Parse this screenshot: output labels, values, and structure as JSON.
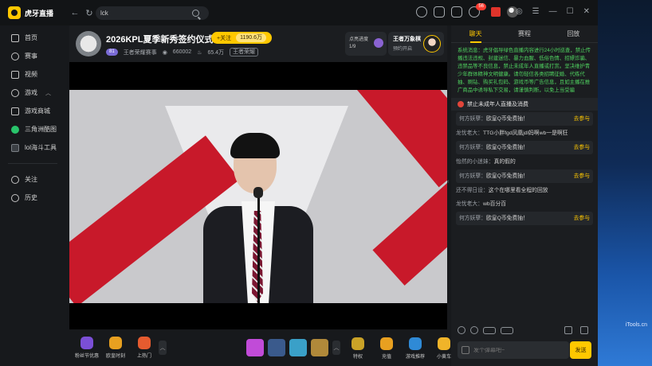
{
  "app": {
    "name": "虎牙直播",
    "search_value": "lck",
    "message_count": "56"
  },
  "sidebar": {
    "items": [
      {
        "label": "首页",
        "icon": "home-icon"
      },
      {
        "label": "赛事",
        "icon": "trophy-icon"
      },
      {
        "label": "视频",
        "icon": "video-icon"
      },
      {
        "label": "游戏",
        "icon": "gamepad-icon"
      },
      {
        "label": "游戏商城",
        "icon": "store-icon"
      },
      {
        "label": "三角洲酷图",
        "icon": "map-icon"
      },
      {
        "label": "lol海斗工具",
        "icon": "tool-icon"
      },
      {
        "label": "关注",
        "icon": "user-follow-icon"
      },
      {
        "label": "历史",
        "icon": "history-icon"
      }
    ]
  },
  "room": {
    "title": "2026KPL夏季新秀签约仪式",
    "follow_label": "+关注",
    "follow_count": "1190.6万",
    "level": "81",
    "host": "王者荣耀赛事",
    "viewers": "660002",
    "heat": "65.4万",
    "category": "王者荣耀",
    "rank_label": "点亮进度",
    "rank_value": "1/9",
    "anchor_name": "王者万象棋",
    "anchor_sub": "预约开启"
  },
  "giftbar": {
    "items": [
      {
        "label": "粉丝节优惠",
        "color": "#7b4fd6"
      },
      {
        "label": "欧皇时刻",
        "color": "#e8a020"
      },
      {
        "label": "上热门",
        "color": "#e55b2f"
      }
    ],
    "gifts": [
      {
        "color": "#c14bd8"
      },
      {
        "color": "#3a5a8c"
      },
      {
        "color": "#3aa0c8"
      },
      {
        "color": "#b0893a"
      }
    ],
    "right_items": [
      {
        "label": "特权",
        "color": "#c9a227"
      },
      {
        "label": "充值",
        "color": "#e8a020"
      },
      {
        "label": "游戏推荐",
        "color": "#2f8ad6"
      },
      {
        "label": "小黄车",
        "color": "#f0b429"
      }
    ]
  },
  "chat": {
    "tabs": [
      "聊天",
      "赛程",
      "回放"
    ],
    "system_message": "系统消息：虎牙倡导绿色直播内容进行24小时巡查，禁止传播违法违规、封建迷信、暴力血腥、低俗色情、招嫖诈骗、违禁品等不良信息，禁止未成年人直播或打赏。坚决维护青少年群体精神文明健康。请勿轻信各类招聘征婚、代练代抽、刷钻、购买礼包码、游戏币等广告信息，且如主播在推广商品中诱导私下交易，请谨慎判断，以免上当受骗",
    "notice": "禁止未成年人直播及消费",
    "messages": [
      {
        "type": "promo",
        "user": "何方妖孽：",
        "text": "欧皇Q币免费抽！",
        "action": "去参与"
      },
      {
        "type": "text",
        "user": "龙忧老大：",
        "text": "TTG小胖fgd凤凰jdl妈啊wb一是啊狂"
      },
      {
        "type": "promo",
        "user": "何方妖孽：",
        "text": "欧皇Q币免费抽！",
        "action": "去参与"
      },
      {
        "type": "text",
        "user": "怡然的小迷妹：",
        "text": "真的假的"
      },
      {
        "type": "promo",
        "user": "何方妖孽：",
        "text": "欧皇Q币免费抽！",
        "action": "去参与"
      },
      {
        "type": "text",
        "user": "还不得日设：",
        "text": "这个在哪里看全程的回放"
      },
      {
        "type": "text",
        "user": "龙忧老大：",
        "text": "wb百分百"
      },
      {
        "type": "promo",
        "user": "何方妖孽：",
        "text": "欧皇Q币免费抽！",
        "action": "去参与"
      }
    ],
    "input_placeholder": "发个弹幕吧~",
    "send_label": "发送"
  },
  "desktop": {
    "watermark": "iTools.cn"
  }
}
